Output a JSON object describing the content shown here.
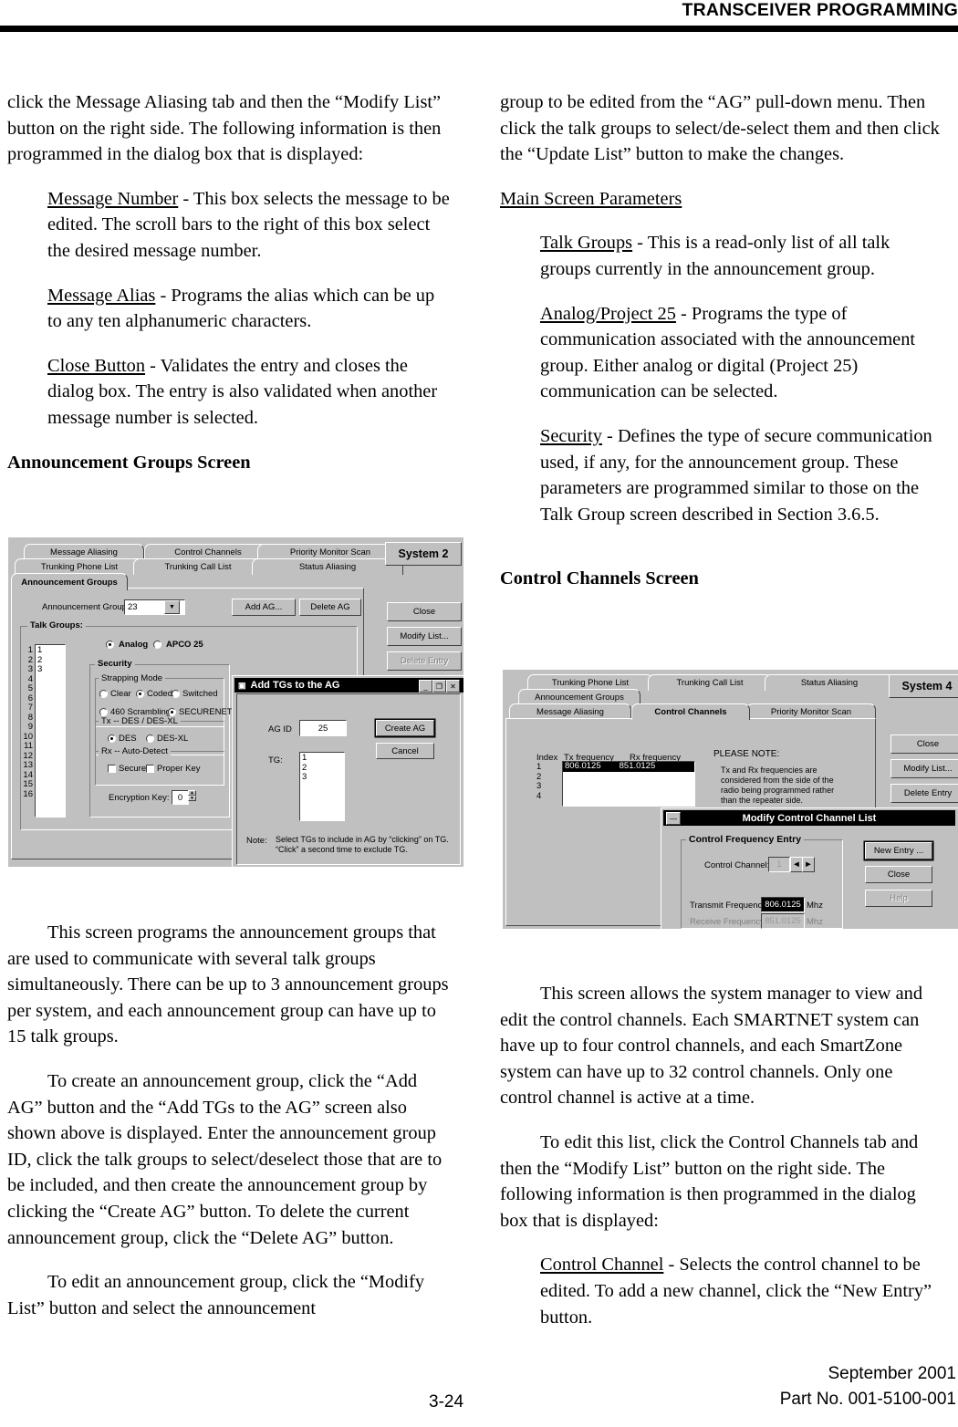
{
  "header": {
    "title": "TRANSCEIVER PROGRAMMING"
  },
  "footer": {
    "page_number": "3-24",
    "date": "September 2001",
    "part_no": "Part No. 001-5100-001"
  },
  "left_column": {
    "intro": "click the Message Aliasing tab and then the “Modify List” button on the right side. The following information is then programmed in the dialog box that is displayed:",
    "params": [
      {
        "term": "Message Number",
        "desc": " - This box selects the message to be edited. The scroll bars to the right of this box select the desired message number."
      },
      {
        "term": "Message Alias",
        "desc": " - Programs the alias which can be up to any ten alphanumeric characters."
      },
      {
        "term": "Close Button",
        "desc": " - Validates the entry and closes the dialog box. The entry is also validated when another message number is selected."
      }
    ],
    "section_heading": "Announcement Groups Screen",
    "para1": "This screen programs the announcement groups that are used to communicate with several talk groups simultaneously. There can be up to 3 announcement groups per system, and each announcement group can have up to 15 talk groups.",
    "para2": "To create an announcement group, click the “Add AG” button and the “Add TGs to the AG” screen also shown above is displayed. Enter the announcement group ID, click the talk groups to select/deselect those that are to be included, and then create the announcement group by clicking the “Create AG” button. To delete the current announcement group, click the “Delete AG” button.",
    "para3": "To edit an announcement group, click the “Modify List” button and select the announcement"
  },
  "right_column": {
    "continuation": "group to be edited from the “AG” pull-down menu. Then click the talk groups to select/de-select them and then click the “Update List” button to make the changes.",
    "main_screen_heading": "Main Screen Parameters",
    "params": [
      {
        "term": "Talk Groups",
        "desc": " - This is a read-only list of all talk groups currently in the announcement group."
      },
      {
        "term": "Analog/Project 25",
        "desc": " - Programs the type of communication associated with the announcement group. Either analog or digital (Project 25) communication can be selected."
      },
      {
        "term": "Security",
        "desc": " - Defines the type of secure communication used, if any, for the announcement group. These parameters are programmed similar to those on the Talk Group screen described in Section 3.6.5."
      }
    ],
    "section_heading": "Control Channels Screen",
    "para1": "This screen allows the system manager to view and edit the control channels. Each SMARTNET system can have up to four control channels, and each SmartZone system can have up to 32 control channels. Only one control channel is active at a time.",
    "para2": "To edit this list, click the Control Channels tab and then the “Modify List” button on the right side. The following information is then programmed in the dialog box that is displayed:",
    "params2": [
      {
        "term": "Control Channel",
        "desc": " - Selects the control channel to be edited. To add a new channel, click the “New Entry” button."
      }
    ]
  },
  "figure_ag": {
    "tabs_row1": [
      "Message Aliasing",
      "Control Channels",
      "Priority Monitor Scan"
    ],
    "tabs_row2": [
      "Trunking Phone List",
      "Trunking Call List",
      "Status Aliasing"
    ],
    "tab_active": "Announcement Groups",
    "system_label": "System 2",
    "side_buttons": [
      "Close",
      "Modify List...",
      "Delete Entry"
    ],
    "ag_label": "Announcement Group:",
    "ag_value": "23",
    "add_ag_button": "Add AG...",
    "delete_ag_button": "Delete AG",
    "talk_groups_label": "Talk Groups:",
    "talk_group_indices": [
      "1",
      "2",
      "3",
      "4",
      "5",
      "6",
      "7",
      "8",
      "9",
      "10",
      "11",
      "12",
      "13",
      "14",
      "15",
      "16"
    ],
    "talk_group_values": [
      "1",
      "2",
      "3"
    ],
    "mode_radios": [
      "Analog",
      "APCO 25"
    ],
    "mode_selected": "Analog",
    "security_label": "Security",
    "strapping_label": "Strapping Mode",
    "strapping_options": [
      "Clear",
      "Coded",
      "Switched"
    ],
    "strapping_selected": "Coded",
    "scramble_options": [
      "460 Scrambling",
      "SECURENET"
    ],
    "scramble_selected": "SECURENET",
    "tx_group_label": "Tx -- DES / DES-XL",
    "tx_options": [
      "DES",
      "DES-XL"
    ],
    "tx_selected": "DES",
    "rx_group_label": "Rx -- Auto-Detect",
    "rx_options": [
      "Secure",
      "Proper Key"
    ],
    "encryption_label": "Encryption Key:",
    "encryption_value": "0",
    "dialog": {
      "title": "Add TGs to the AG",
      "ag_id_label": "AG ID",
      "ag_id_value": "25",
      "tg_label": "TG:",
      "tg_values": [
        "1",
        "2",
        "3"
      ],
      "create_button": "Create AG",
      "cancel_button": "Cancel",
      "note_label": "Note:",
      "note_line1": "Select TGs to include in AG by “clicking” on TG.",
      "note_line2": "“Click” a second time to exclude TG."
    }
  },
  "figure_cc": {
    "tabs_row1": [
      "Trunking Phone List",
      "Trunking Call List",
      "Status Aliasing"
    ],
    "tabs_row2": [
      "Announcement Groups"
    ],
    "tabs_row3": [
      "Message Aliasing",
      "Control Channels",
      "Priority Monitor Scan"
    ],
    "tab_active": "Control Channels",
    "system_label": "System 4",
    "side_buttons": [
      "Close",
      "Modify List...",
      "Delete Entry"
    ],
    "table_headers": [
      "Index",
      "Tx frequency",
      "Rx frequency"
    ],
    "table_rows": [
      {
        "index": "1",
        "tx": "806.0125",
        "rx": "851.0125",
        "selected": true
      },
      {
        "index": "2",
        "tx": "",
        "rx": "",
        "selected": false
      },
      {
        "index": "3",
        "tx": "",
        "rx": "",
        "selected": false
      },
      {
        "index": "4",
        "tx": "",
        "rx": "",
        "selected": false
      }
    ],
    "note_title": "PLEASE NOTE:",
    "note_lines": [
      "Tx and Rx frequencies are",
      "considered from the side of the",
      "radio being programmed rather",
      "than the repeater side."
    ],
    "dialog": {
      "title": "Modify Control Channel List",
      "group_label": "Control Frequency Entry",
      "control_channel_label": "Control Channel:",
      "control_channel_value": "1",
      "transmit_label": "Transmit Frequency",
      "transmit_value": "806.0125",
      "receive_label": "Receive Frequency",
      "receive_value": "851.0125",
      "unit": "Mhz",
      "buttons": [
        "New Entry ...",
        "Close",
        "Help"
      ]
    }
  }
}
